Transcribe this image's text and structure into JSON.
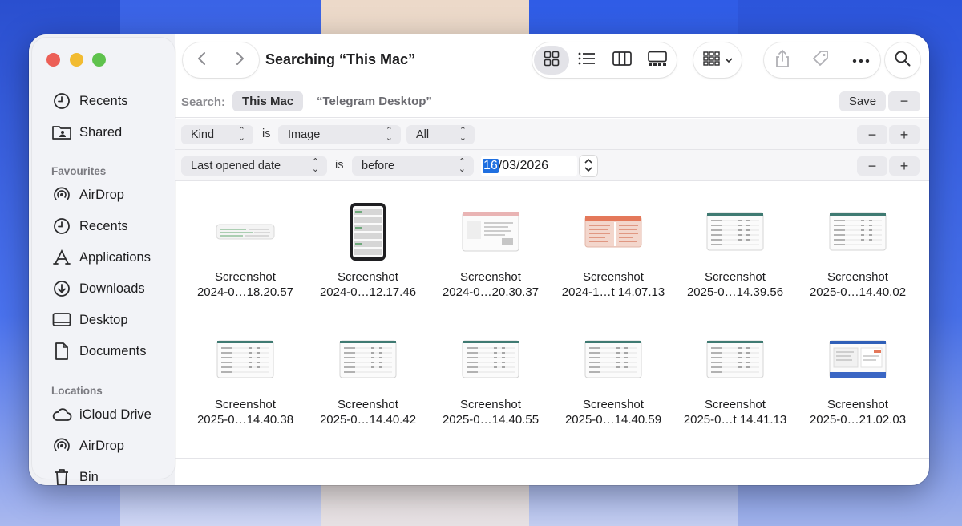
{
  "window": {
    "title": "Searching “This Mac”"
  },
  "sidebar": {
    "top_items": [
      {
        "label": "Recents",
        "icon": "clock-icon"
      },
      {
        "label": "Shared",
        "icon": "shared-folder-icon"
      }
    ],
    "favourites_heading": "Favourites",
    "favourites": [
      {
        "label": "AirDrop",
        "icon": "airdrop-icon"
      },
      {
        "label": "Recents",
        "icon": "clock-icon"
      },
      {
        "label": "Applications",
        "icon": "applications-icon"
      },
      {
        "label": "Downloads",
        "icon": "download-icon"
      },
      {
        "label": "Desktop",
        "icon": "desktop-icon"
      },
      {
        "label": "Documents",
        "icon": "document-icon"
      }
    ],
    "locations_heading": "Locations",
    "locations": [
      {
        "label": "iCloud Drive",
        "icon": "cloud-icon"
      },
      {
        "label": "AirDrop",
        "icon": "airdrop-icon"
      },
      {
        "label": "Bin",
        "icon": "bin-icon"
      }
    ]
  },
  "searchbar": {
    "label": "Search:",
    "scope_active": "This Mac",
    "scope_other": "“Telegram Desktop”",
    "save_label": "Save",
    "minus": "−"
  },
  "criteria": [
    {
      "attribute": "Kind",
      "operator": "is",
      "value": "Image",
      "value2": "All",
      "minus": "−",
      "plus": "+"
    },
    {
      "attribute": "Last opened date",
      "operator": "is",
      "value": "before",
      "date_selected": "16",
      "date_rest": "/03/2026",
      "minus": "−",
      "plus": "+"
    }
  ],
  "files": [
    {
      "line1": "Screenshot",
      "line2": "2024-0…18.20.57",
      "thumb": "strip"
    },
    {
      "line1": "Screenshot",
      "line2": "2024-0…12.17.46",
      "thumb": "phone"
    },
    {
      "line1": "Screenshot",
      "line2": "2024-0…20.30.37",
      "thumb": "pinkweb"
    },
    {
      "line1": "Screenshot",
      "line2": "2024-1…t 14.07.13",
      "thumb": "orange"
    },
    {
      "line1": "Screenshot",
      "line2": "2025-0…14.39.56",
      "thumb": "table"
    },
    {
      "line1": "Screenshot",
      "line2": "2025-0…14.40.02",
      "thumb": "table"
    },
    {
      "line1": "Screenshot",
      "line2": "2025-0…14.40.38",
      "thumb": "table"
    },
    {
      "line1": "Screenshot",
      "line2": "2025-0…14.40.42",
      "thumb": "table"
    },
    {
      "line1": "Screenshot",
      "line2": "2025-0…14.40.55",
      "thumb": "table"
    },
    {
      "line1": "Screenshot",
      "line2": "2025-0…14.40.59",
      "thumb": "table"
    },
    {
      "line1": "Screenshot",
      "line2": "2025-0…t 14.41.13",
      "thumb": "table"
    },
    {
      "line1": "Screenshot",
      "line2": "2025-0…21.02.03",
      "thumb": "blueweb"
    }
  ],
  "colors": {
    "close": "#ec5f57",
    "minimize": "#f2bb31",
    "zoom": "#5fc24d",
    "selection": "#1f6fe0"
  }
}
